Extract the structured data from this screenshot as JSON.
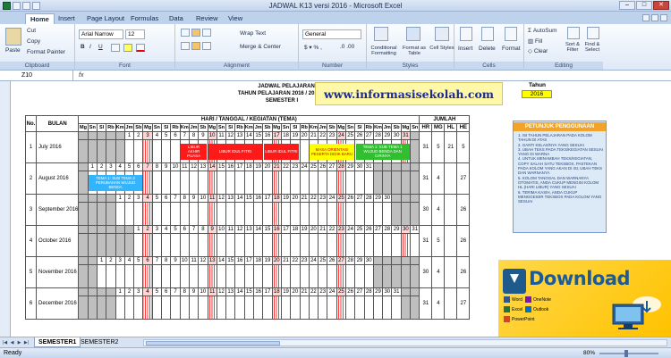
{
  "window": {
    "title": "JADWAL K13 versi 2016 - Microsoft Excel"
  },
  "ribbon_tabs": [
    "Home",
    "Insert",
    "Page Layout",
    "Formulas",
    "Data",
    "Review",
    "View"
  ],
  "ribbon": {
    "clipboard": {
      "paste": "Paste",
      "cut": "Cut",
      "copy": "Copy",
      "format_painter": "Format Painter",
      "label": "Clipboard"
    },
    "font": {
      "family": "Arial Narrow",
      "size": "12",
      "label": "Font"
    },
    "alignment": {
      "wrap_text": "Wrap Text",
      "merge_center": "Merge & Center",
      "label": "Alignment"
    },
    "number": {
      "format": "General",
      "label": "Number"
    },
    "styles": {
      "conditional": "Conditional Formatting",
      "format_table": "Format as Table",
      "cell_styles": "Cell Styles",
      "label": "Styles"
    },
    "cells": {
      "insert": "Insert",
      "delete": "Delete",
      "format": "Format",
      "label": "Cells"
    },
    "editing": {
      "autosum": "AutoSum",
      "fill": "Fill",
      "clear": "Clear",
      "sort_filter": "Sort & Filter",
      "find_select": "Find & Select",
      "label": "Editing"
    }
  },
  "formula_bar": {
    "name_box": "Z10",
    "fx": "fx"
  },
  "sheet": {
    "watermark": "www.informasisekolah.com",
    "heading1": "JADWAL PELAJARAN",
    "heading2": "TAHUN PELAJARAN 2016 / 2017",
    "heading3": "SEMESTER I",
    "tahun_label": "Tahun",
    "tahun_value": "2016",
    "col_no": "No.",
    "col_bulan": "BULAN",
    "col_hari": "HARI / TANGGAL / KEGIATAN (TEMA)",
    "col_jumlah": "JUMLAH",
    "jumlah_headers": [
      "HR",
      "MG",
      "HL",
      "HE"
    ],
    "day_headers": [
      "Mg",
      "Sn",
      "Sl",
      "Rb",
      "Km",
      "Jm",
      "Sb",
      "Mg",
      "Sn",
      "Sl",
      "Rb",
      "Km",
      "Jm",
      "Sb",
      "Mg",
      "Sn",
      "Sl",
      "Rb",
      "Km",
      "Jm",
      "Sb",
      "Mg",
      "Sn",
      "Sl",
      "Rb",
      "Km",
      "Jm",
      "Sb",
      "Mg",
      "Sn",
      "Sl",
      "Rb",
      "Km",
      "Jm",
      "Sb",
      "Mg",
      "Sn"
    ],
    "months": [
      {
        "no": "1",
        "name": "July 2016",
        "start": 5,
        "days": 31,
        "totals": [
          "31",
          "5",
          "21",
          "5"
        ],
        "events": [
          {
            "text": "LIBUR AKHIR PUASA",
            "from": 7,
            "to": 9,
            "color": "#ff1a1a",
            "fg": "#fff"
          },
          {
            "text": "LIBUR IDUL FITRI",
            "from": 10,
            "to": 15,
            "color": "#ff1a1a",
            "fg": "#fff"
          },
          {
            "text": "LIBUR IDUL FITRI",
            "from": 16,
            "to": 19,
            "color": "#ff1a1a",
            "fg": "#fff"
          },
          {
            "text": "MASA ORIENTASI PESERTA DIDIK BARU",
            "from": 21,
            "to": 25,
            "color": "#ffff00",
            "fg": "#c00"
          },
          {
            "text": "TEMA 1: SUB TEMA 1 WUJUD BENDA DAN CIRINYA",
            "from": 26,
            "to": 31,
            "color": "#2fbf2f",
            "fg": "#fff"
          }
        ]
      },
      {
        "no": "2",
        "name": "August 2016",
        "start": 1,
        "days": 31,
        "totals": [
          "31",
          "4",
          "",
          "27"
        ],
        "events": [
          {
            "text": "TEMA 1: SUB TEMA 2 PERUBAHAN WUJUD BENDA",
            "from": 1,
            "to": 6,
            "color": "#33b4ff",
            "fg": "#fff"
          }
        ]
      },
      {
        "no": "3",
        "name": "September 2016",
        "start": 4,
        "days": 30,
        "totals": [
          "30",
          "4",
          "",
          "26"
        ],
        "events": []
      },
      {
        "no": "4",
        "name": "October 2016",
        "start": 6,
        "days": 31,
        "totals": [
          "31",
          "5",
          "",
          "26"
        ],
        "events": []
      },
      {
        "no": "5",
        "name": "November 2016",
        "start": 2,
        "days": 30,
        "totals": [
          "30",
          "4",
          "",
          "26"
        ],
        "events": []
      },
      {
        "no": "6",
        "name": "December 2016",
        "start": 4,
        "days": 31,
        "totals": [
          "31",
          "4",
          "",
          "27"
        ],
        "events": []
      }
    ]
  },
  "petunjuk": {
    "title": "PETUNJUK PENGGUNAAN",
    "items": [
      "1. ISI TAHUN PELAJARAN PADA KOLOM TAHUN DI ATAS",
      "2. GANTI KELAS/NYA YANG SESUAI",
      "3. UBAH TEKS PADA TEKS/KEGIATAN SESUAI YANG DI WARNA",
      "4. UNTUK MENAMBAH TEKS/KEGIATAN, COPY SALAH SATU TEKSBOX, PASTEKAN PADA KOLOM YANG AKAN DI ISI, UBAH TEKS DAN WARNANYA",
      "5. KOLOM TANGGAL DAN WARNANYA OTOMATIS, ANDA CUKUP MENGISI KOLOM HL (HARI LIBUR) YANG SESUAI",
      "6. TERIMA KASIH, ANDA CUKUP MENGGESER TEKSBOX PADA KOLOM YANG SESUAI"
    ]
  },
  "promo": {
    "download": "Download",
    "apps": [
      "Word",
      "OneNote",
      "Excel",
      "Outlook",
      "PowerPoint"
    ]
  },
  "sheet_tabs": [
    "SEMESTER1",
    "SEMESTER2"
  ],
  "status": {
    "ready": "Ready",
    "zoom": "80%"
  }
}
